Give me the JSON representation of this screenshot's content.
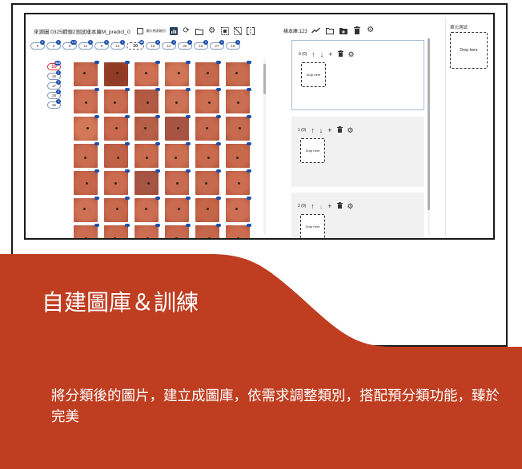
{
  "app": {
    "source_label": "來源圖:0325鋼頭2測試樣本庫M_predict_0",
    "checkbox_label": "顯示預測類別",
    "icons": [
      "bar-chart-icon",
      "refresh-icon",
      "folder-icon",
      "gear-icon",
      "select-all-icon",
      "deselect-icon",
      "split-icon"
    ]
  },
  "top_chips": [
    {
      "label": "0",
      "count": "8"
    },
    {
      "label": "3",
      "count": "4"
    },
    {
      "label": "5",
      "count": "110"
    },
    {
      "label": "11",
      "count": "3"
    },
    {
      "label": "8",
      "count": "8"
    },
    {
      "label": "14",
      "count": "4"
    },
    {
      "label": "10",
      "count": "43",
      "selected": true
    },
    {
      "label": "16",
      "count": "5"
    },
    {
      "label": "12",
      "count": "4"
    },
    {
      "label": "25",
      "count": "2"
    },
    {
      "label": "15",
      "count": "9"
    },
    {
      "label": "27",
      "count": "3"
    },
    {
      "label": "18",
      "count": "4"
    }
  ],
  "side_chips": [
    {
      "label": "10",
      "count": "424",
      "selected": true
    },
    {
      "label": "16",
      "count": "2"
    },
    {
      "label": "17",
      "count": "3"
    },
    {
      "label": "38",
      "count": "5"
    },
    {
      "label": "46",
      "count": "4"
    }
  ],
  "thumbnails": {
    "rows": 7,
    "cols": 6,
    "tile_colors": [
      [
        "#c86a4e",
        "#8f3b25",
        "#cf7055",
        "#d07656",
        "#c5684d",
        "#c86c50"
      ],
      [
        "#cc6f54",
        "#c96b50",
        "#b35a42",
        "#cd7256",
        "#cb6e52",
        "#c96e52"
      ],
      [
        "#d27858",
        "#c8694d",
        "#b66049",
        "#a85444",
        "#c7694e",
        "#c56a4e"
      ],
      [
        "#c96b50",
        "#c06248",
        "#c76a4e",
        "#cc6e52",
        "#c9694e",
        "#c8694c"
      ],
      [
        "#c8664c",
        "#cb6c50",
        "#a65443",
        "#c96b52",
        "#c56a4f",
        "#cc6d52"
      ],
      [
        "#ce7054",
        "#c8694d",
        "#cc6e53",
        "#ca6b51",
        "#c56649",
        "#cc6f55"
      ],
      [
        "#cb6b50",
        "#c96a4e",
        "#cc6c52",
        "#c9694f",
        "#c6664c",
        "#cb6c51"
      ]
    ]
  },
  "library": {
    "title": "樣本庫:123",
    "icons": [
      "trend-icon",
      "folder-icon",
      "add-folder-icon",
      "trash-icon",
      "gear-icon"
    ],
    "groups": [
      {
        "label": "0 (0)",
        "drop_text": "Drop here",
        "down_disabled": false
      },
      {
        "label": "1 (0)",
        "drop_text": "Drop here",
        "down_disabled": false
      },
      {
        "label": "2 (0)",
        "drop_text": "Drop here",
        "down_disabled": true
      }
    ]
  },
  "unit_test": {
    "title": "單元測試",
    "drop_text": "Drop here"
  },
  "banner": {
    "title": "自建圖庫＆訓練",
    "description": "將分類後的圖片，建立成圖庫，依需求調整類別，搭配預分類功能，臻於完美",
    "color": "#bf3e21"
  }
}
